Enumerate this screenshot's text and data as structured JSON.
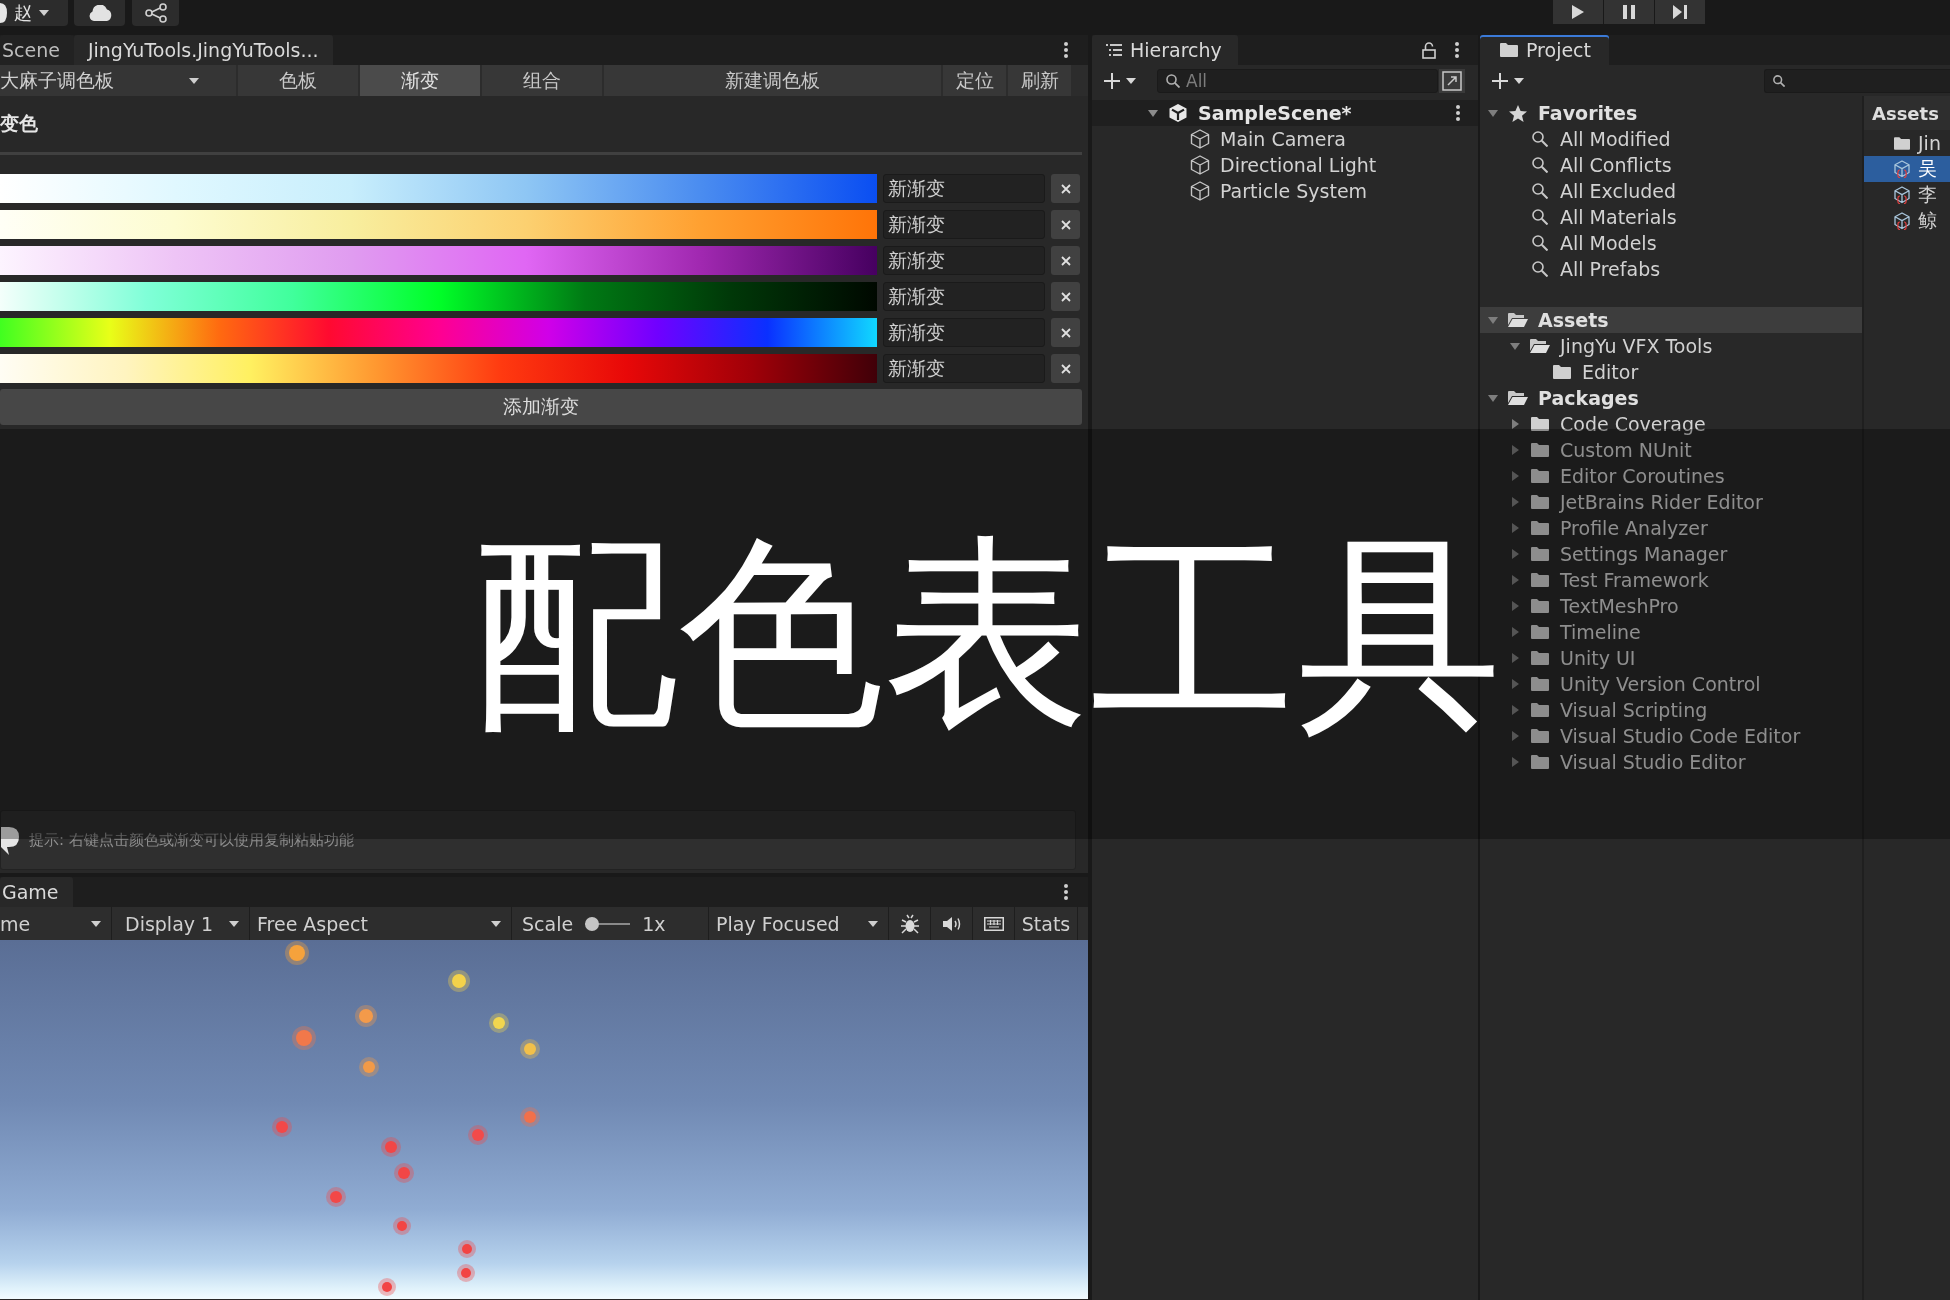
{
  "toolbar": {
    "account": {
      "label": "赵"
    }
  },
  "editor_panel": {
    "focused": false,
    "tabs": [
      {
        "label": "Scene",
        "selected": false
      },
      {
        "label": "JingYuTools.JingYuTools...",
        "selected": true
      }
    ],
    "palette_dropdown": {
      "value": "大麻子调色板"
    },
    "mode_tabs": [
      {
        "label": "色板",
        "selected": false
      },
      {
        "label": "渐变",
        "selected": true
      },
      {
        "label": "组合",
        "selected": false
      }
    ],
    "buttons": [
      "新建调色板",
      "定位",
      "刷新"
    ],
    "section_title": "变色",
    "gradients": [
      {
        "name": "新渐变"
      },
      {
        "name": "新渐变"
      },
      {
        "name": "新渐变"
      },
      {
        "name": "新渐变"
      },
      {
        "name": "新渐变"
      },
      {
        "name": "新渐变"
      }
    ],
    "add_button": "添加渐变",
    "hint": "提示: 右键点击颜色或渐变可以使用复制粘贴功能"
  },
  "game_panel": {
    "focused": false,
    "tabs": [
      {
        "label": "Game",
        "selected": true
      }
    ],
    "toolbar": {
      "view_dropdown": "me",
      "display_dropdown": "Display 1",
      "aspect_dropdown": "Free Aspect",
      "scale": {
        "label": "Scale",
        "level": 0,
        "reading": "1x"
      },
      "play_mode_dropdown": "Play Focused",
      "stats_button": "Stats"
    }
  },
  "hierarchy": {
    "focused": false,
    "tabs": [
      {
        "label": "Hierarchy",
        "selected": true
      }
    ],
    "search": {
      "placeholder": "All"
    },
    "scene": {
      "label": "SampleScene*",
      "expanded": true,
      "children": [
        {
          "label": "Main Camera"
        },
        {
          "label": "Directional Light"
        },
        {
          "label": "Particle System"
        }
      ]
    }
  },
  "project": {
    "focused": true,
    "tabs": [
      {
        "label": "Project",
        "selected": true
      }
    ],
    "tree": [
      {
        "label": "Favorites",
        "kind": "favorites",
        "expanded": true,
        "selected": false,
        "children": [
          {
            "label": "All Modified",
            "kind": "search",
            "selected": false
          },
          {
            "label": "All Conflicts",
            "kind": "search",
            "selected": false
          },
          {
            "label": "All Excluded",
            "kind": "search",
            "selected": false
          },
          {
            "label": "All Materials",
            "kind": "search",
            "selected": false
          },
          {
            "label": "All Models",
            "kind": "search",
            "selected": false
          },
          {
            "label": "All Prefabs",
            "kind": "search",
            "selected": false
          }
        ]
      },
      {
        "label": "Assets",
        "kind": "folder",
        "expanded": true,
        "selected": true,
        "children": [
          {
            "label": "JingYu VFX Tools",
            "kind": "folder",
            "expanded": true,
            "selected": false,
            "children": [
              {
                "label": "Editor",
                "kind": "folder",
                "selected": false
              }
            ]
          }
        ]
      },
      {
        "label": "Packages",
        "kind": "folder",
        "expanded": true,
        "selected": false,
        "children": [
          {
            "label": "Code Coverage",
            "kind": "folder",
            "expanded": false,
            "selected": false
          },
          {
            "label": "Custom NUnit",
            "kind": "folder",
            "expanded": false,
            "selected": false
          },
          {
            "label": "Editor Coroutines",
            "kind": "folder",
            "expanded": false,
            "selected": false
          },
          {
            "label": "JetBrains Rider Editor",
            "kind": "folder",
            "expanded": false,
            "selected": false
          },
          {
            "label": "Profile Analyzer",
            "kind": "folder",
            "expanded": false,
            "selected": false
          },
          {
            "label": "Settings Manager",
            "kind": "folder",
            "expanded": false,
            "selected": false
          },
          {
            "label": "Test Framework",
            "kind": "folder",
            "expanded": false,
            "selected": false
          },
          {
            "label": "TextMeshPro",
            "kind": "folder",
            "expanded": false,
            "selected": false
          },
          {
            "label": "Timeline",
            "kind": "folder",
            "expanded": false,
            "selected": false
          },
          {
            "label": "Unity UI",
            "kind": "folder",
            "expanded": false,
            "selected": false
          },
          {
            "label": "Unity Version Control",
            "kind": "folder",
            "expanded": false,
            "selected": false
          },
          {
            "label": "Visual Scripting",
            "kind": "folder",
            "expanded": false,
            "selected": false
          },
          {
            "label": "Visual Studio Code Editor",
            "kind": "folder",
            "expanded": false,
            "selected": false
          },
          {
            "label": "Visual Studio Editor",
            "kind": "folder",
            "expanded": false,
            "selected": false
          }
        ]
      }
    ],
    "assets": {
      "title": "Assets",
      "items": [
        {
          "label": "Jin",
          "kind": "folder",
          "selected": false
        },
        {
          "label": "吴",
          "kind": "asset",
          "selected": true
        },
        {
          "label": "李",
          "kind": "asset",
          "selected": false
        },
        {
          "label": "鲸",
          "kind": "asset",
          "selected": false
        }
      ]
    }
  },
  "banner": {
    "title": "配色表工具"
  }
}
